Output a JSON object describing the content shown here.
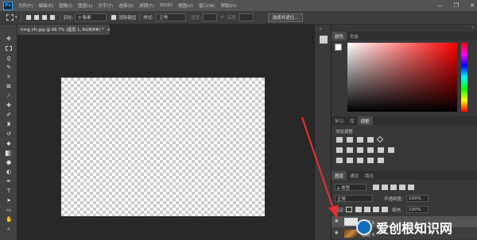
{
  "app": {
    "logo": "Ps"
  },
  "menu": [
    "文件(F)",
    "编辑(E)",
    "图像(I)",
    "图层(L)",
    "文字(Y)",
    "选择(S)",
    "滤镜(T)",
    "3D(D)",
    "视图(V)",
    "窗口(W)",
    "帮助(H)"
  ],
  "window_controls": {
    "minimize": "—",
    "restore": "❐",
    "close": "✕"
  },
  "options": {
    "feather_label": "羽化:",
    "feather_value": "0 像素",
    "antialias_label": "消除锯齿",
    "style_label": "样式:",
    "style_value": "正常",
    "width_label": "宽度:",
    "height_label": "高度:",
    "select_mask_button": "选择并遮住..."
  },
  "document": {
    "tab_title": "timg (4).jpg @ 66.7% (图层 1, RGB/8#) *",
    "close": "×"
  },
  "panels": {
    "color_tabs": [
      "颜色",
      "色板"
    ],
    "adjust_tabs": [
      "学习",
      "库",
      "调整"
    ],
    "adjust_active": "调整",
    "adjust_add_label": "添加调整",
    "layers_tabs": [
      "图层",
      "通道",
      "路径"
    ],
    "layers_active": "图层",
    "kind_filter": "ρ 类型",
    "blend_mode": "正常",
    "opacity_label": "不透明度:",
    "opacity_value": "100%",
    "lock_label": "锁定:",
    "fill_label": "填充:",
    "fill_value": "100%",
    "layer_items": [
      {
        "name": "图层 1",
        "selected": true
      },
      {
        "name": "图层 0",
        "selected": false
      }
    ]
  },
  "colors": {
    "accent_arrow": "#e03030",
    "foreground": "#ffffff",
    "background": "#c8102e"
  },
  "watermark": {
    "text": "爱创根知识网"
  }
}
